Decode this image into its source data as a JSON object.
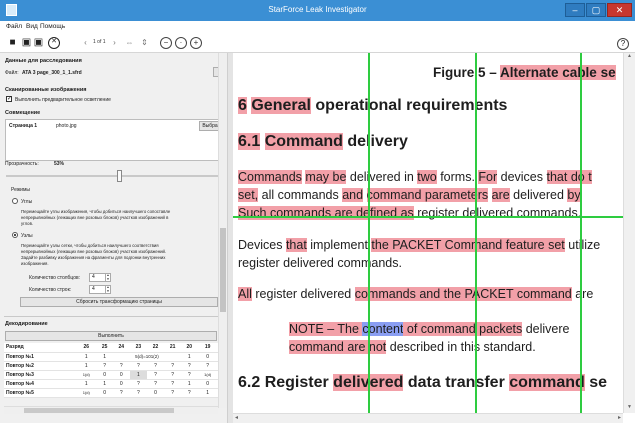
{
  "window": {
    "title": "StarForce Leak Investigator",
    "controls": {
      "minimize": "–",
      "maximize": "▢",
      "close": "✕"
    }
  },
  "menu": [
    "Файл",
    "Вид",
    "Помощь"
  ],
  "toolbar": {
    "page_indicator": "1 of 1",
    "icons": [
      "folder-open-icon",
      "save-icon",
      "save-as-icon",
      "cancel-icon",
      "prev-page-icon",
      "next-page-icon",
      "fit-width-icon",
      "fit-height-icon",
      "zoom-out-icon",
      "zoom-fit-icon",
      "zoom-in-icon",
      "help-icon"
    ],
    "help_label": "?"
  },
  "left": {
    "investigation_header": "Данные для расследования",
    "file_label": "Файл:",
    "file_value": "ATA 3 page_300_1_1.sfrd",
    "scanned_header": "Сканированные изображения",
    "preclarify_label": "Выполнить предварительное осветление",
    "preclarify_checked": true,
    "alignment_header": "Совмещение",
    "page_column": "Страница 1",
    "image_file": "photo.jpg",
    "browse_label": "Выбра",
    "transparency_label": "Прозрачность:",
    "transparency_value": "53%",
    "transparency_level": 0.53,
    "modes_label": "Режимы",
    "mode_corners_label": "Углы",
    "mode_corners_desc": [
      "Перемещайте углы изображения, чтобы добиться наилучшего сопоставле",
      "непрерывнойных (лежащих вне розовых блоков) участков изображений в",
      "углов."
    ],
    "mode_grid_label": "Узлы",
    "mode_grid_desc": [
      "Перемещайте узлы сетки, чтобы добиться наилучшего соответствия",
      "непрерывнойных (лежащих вне розовых блоков) участков изображений.",
      "Задайте разбивку изображения на фрагменты для подгонки внутренних",
      "изображения."
    ],
    "columns_label": "Количество столбцов:",
    "columns_value": "4",
    "rows_label": "Количество строк:",
    "rows_value": "4",
    "reset_button": "Сбросить трансформацию страницы",
    "decode_header": "Декодирование",
    "run_button": "Выполнить",
    "table": {
      "corner": "Разряд",
      "columns": [
        "26",
        "25",
        "24",
        "23",
        "22",
        "21",
        "20",
        "19"
      ],
      "rows": [
        {
          "name": "Повтор №1",
          "cells": [
            "1",
            "1",
            "5(d)=101(2)",
            "",
            "",
            "",
            "1",
            "0"
          ]
        },
        {
          "name": "Повтор №2",
          "cells": [
            "1",
            "?",
            "?",
            "?",
            "?",
            "?",
            "?",
            "?"
          ]
        },
        {
          "name": "Повтор №3",
          "cells": [
            "1(d)",
            "0",
            "0",
            "1",
            "?",
            "?",
            "?",
            "1(d)"
          ]
        },
        {
          "name": "Повтор №4",
          "cells": [
            "1",
            "1",
            "0",
            "?",
            "?",
            "?",
            "1",
            "0"
          ]
        },
        {
          "name": "Повтор №5",
          "cells": [
            "1(d)",
            "0",
            "?",
            "?",
            "0",
            "?",
            "?",
            "1"
          ]
        }
      ]
    }
  },
  "document": {
    "figure_prefix": "Figure 5 – ",
    "figure_hl": "Alternate cable se",
    "h6_num": "6",
    "h6_word": "General",
    "h6_rest": " operational requirements",
    "h61_num": "6.1",
    "h61_word": "Command",
    "h61_rest": " delivery",
    "p1_l1_a": "Commands",
    "p1_l1_b": " ",
    "p1_l1_c": "may be",
    "p1_l1_d": " delivered in ",
    "p1_l1_e": "two",
    "p1_l1_f": " forms. ",
    "p1_l1_g": "For",
    "p1_l1_h": " devices ",
    "p1_l1_i": "that do t",
    "p1_l2_a": "set,",
    "p1_l2_b": " all commands ",
    "p1_l2_c": "and",
    "p1_l2_d": " ",
    "p1_l2_e": "command parameters",
    "p1_l2_f": " ",
    "p1_l2_g": "are",
    "p1_l2_h": " delivered ",
    "p1_l2_i": "by",
    "p1_l3_a": "Such commands are defined as",
    "p1_l3_b": " register delivered commands.",
    "p2_l1_a": "Devices ",
    "p2_l1_b": "that",
    "p2_l1_c": " implement ",
    "p2_l1_d": "the PACKET Command feature set",
    "p2_l1_e": " utilize",
    "p2_l2": "register delivered commands.",
    "p3_a": "All",
    "p3_b": " register delivered ",
    "p3_c": "commands and the PACKET command",
    "p3_d": " are",
    "note_l1_a": "NOTE – The ",
    "note_l1_b": "content",
    "note_l1_c": " of command packets",
    "note_l1_d": " delivere",
    "note_l2_a": "command are not",
    "note_l2_b": " described in this standard.",
    "h62_num": "6.2",
    "h62_a": " Register ",
    "h62_b": "delivered",
    "h62_c": " data transfer ",
    "h62_d": "command",
    "h62_e": " se"
  },
  "colors": {
    "titlebar": "#3b8fd4",
    "highlight": "#f2a0a8",
    "highlight_blue": "#8a9ef2",
    "grid": "#2ecc40"
  }
}
